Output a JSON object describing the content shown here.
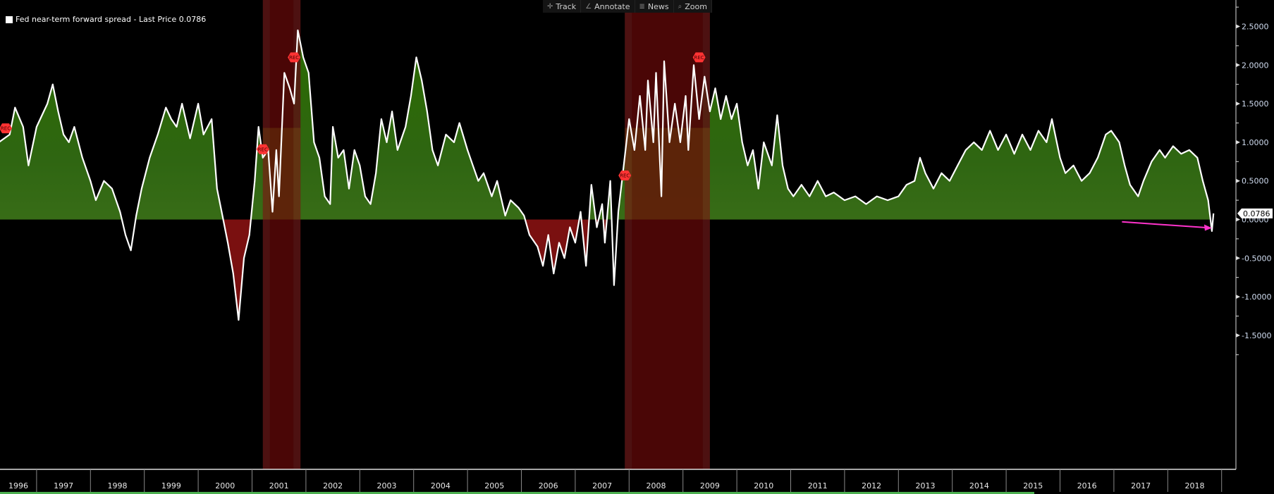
{
  "toolbar": {
    "items": [
      {
        "label": "Track",
        "icon": "crosshair-icon"
      },
      {
        "label": "Annotate",
        "icon": "pencil-icon"
      },
      {
        "label": "News",
        "icon": "news-icon"
      },
      {
        "label": "Zoom",
        "icon": "magnifier-icon"
      }
    ]
  },
  "legend": {
    "label": "Fed near-term forward spread - Last Price 0.0786"
  },
  "colors": {
    "line": "#ffffff",
    "positive_fill": "#3f7a12",
    "negative_fill": "#7a1010",
    "recession": "#4a0000",
    "rec_marker": "#ff3333",
    "arrow": "#ff33cc",
    "axis_text": "#d0dcf0"
  },
  "chart_data": {
    "type": "area",
    "title": "Fed near-term forward spread - Last Price 0.0786",
    "last_price": 0.0786,
    "last_price_label": "0.0786",
    "ylim": [
      -1.75,
      2.85
    ],
    "xlim": [
      1995.68,
      2019.6
    ],
    "yticks": [
      2.5,
      2.0,
      1.5,
      1.0,
      0.5,
      0.0,
      -0.5,
      -1.0,
      -1.5
    ],
    "ytick_labels": [
      "2.5000",
      "2.0000",
      "1.5000",
      "1.0000",
      "0.5000",
      "0.0000",
      "-0.5000",
      "-1.0000",
      "-1.5000"
    ],
    "xtick_labels": [
      "1996",
      "1997",
      "1998",
      "1999",
      "2000",
      "2001",
      "2002",
      "2003",
      "2004",
      "2005",
      "2006",
      "2007",
      "2008",
      "2009",
      "2010",
      "2011",
      "2012",
      "2013",
      "2014",
      "2015",
      "2016",
      "2017",
      "2018"
    ],
    "recessions": [
      [
        2001.2,
        2001.9
      ],
      [
        2007.92,
        2009.5
      ]
    ],
    "negative_shaded_periods": [
      [
        2000.4,
        2001.05
      ],
      [
        2006.0,
        2007.6
      ]
    ],
    "rec_markers": [
      {
        "label": "REC",
        "x": 1995.75,
        "y": 1.18
      },
      {
        "label": "REC",
        "x": 2001.2,
        "y": 0.91
      },
      {
        "label": "REC",
        "x": 2001.78,
        "y": 2.1
      },
      {
        "label": "REC",
        "x": 2007.92,
        "y": 0.57
      },
      {
        "label": "REC",
        "x": 2009.3,
        "y": 2.1
      }
    ],
    "arrow_annotation": {
      "from": [
        2017.15,
        -0.03
      ],
      "to": [
        2018.82,
        -0.11
      ]
    },
    "series": [
      {
        "name": "Fed near-term forward spread",
        "x": [
          1995.7,
          1996.3,
          1996.5,
          1996.6,
          1996.75,
          1996.85,
          1997.0,
          1997.2,
          1997.3,
          1997.4,
          1997.5,
          1997.6,
          1997.7,
          1997.85,
          1998.0,
          1998.1,
          1998.25,
          1998.4,
          1998.55,
          1998.65,
          1998.75,
          1998.85,
          1998.95,
          1999.1,
          1999.25,
          1999.4,
          1999.5,
          1999.6,
          1999.7,
          1999.85,
          2000.0,
          2000.1,
          2000.25,
          2000.35,
          2000.45,
          2000.55,
          2000.65,
          2000.75,
          2000.85,
          2000.95,
          2001.05,
          2001.12,
          2001.2,
          2001.3,
          2001.38,
          2001.45,
          2001.5,
          2001.6,
          2001.7,
          2001.78,
          2001.85,
          2001.95,
          2002.05,
          2002.15,
          2002.25,
          2002.35,
          2002.45,
          2002.5,
          2002.6,
          2002.7,
          2002.8,
          2002.9,
          2003.0,
          2003.1,
          2003.2,
          2003.3,
          2003.4,
          2003.5,
          2003.6,
          2003.7,
          2003.85,
          2003.95,
          2004.05,
          2004.15,
          2004.25,
          2004.35,
          2004.45,
          2004.6,
          2004.75,
          2004.85,
          2005.0,
          2005.1,
          2005.2,
          2005.3,
          2005.45,
          2005.55,
          2005.7,
          2005.8,
          2005.95,
          2006.05,
          2006.15,
          2006.3,
          2006.4,
          2006.5,
          2006.6,
          2006.7,
          2006.8,
          2006.9,
          2007.0,
          2007.1,
          2007.2,
          2007.3,
          2007.4,
          2007.5,
          2007.55,
          2007.65,
          2007.72,
          2007.8,
          2007.9,
          2008.0,
          2008.1,
          2008.2,
          2008.3,
          2008.35,
          2008.45,
          2008.5,
          2008.6,
          2008.65,
          2008.75,
          2008.85,
          2008.95,
          2009.05,
          2009.1,
          2009.2,
          2009.3,
          2009.4,
          2009.5,
          2009.6,
          2009.7,
          2009.8,
          2009.9,
          2010.0,
          2010.1,
          2010.2,
          2010.3,
          2010.4,
          2010.5,
          2010.65,
          2010.75,
          2010.85,
          2010.95,
          2011.05,
          2011.2,
          2011.35,
          2011.5,
          2011.65,
          2011.8,
          2012.0,
          2012.2,
          2012.4,
          2012.6,
          2012.8,
          2013.0,
          2013.15,
          2013.3,
          2013.4,
          2013.5,
          2013.65,
          2013.8,
          2013.95,
          2014.1,
          2014.25,
          2014.4,
          2014.55,
          2014.7,
          2014.85,
          2015.0,
          2015.15,
          2015.3,
          2015.45,
          2015.6,
          2015.75,
          2015.85,
          2016.0,
          2016.1,
          2016.25,
          2016.4,
          2016.55,
          2016.7,
          2016.85,
          2016.95,
          2017.1,
          2017.2,
          2017.3,
          2017.45,
          2017.55,
          2017.7,
          2017.85,
          2017.95,
          2018.1,
          2018.25,
          2018.4,
          2018.55,
          2018.65,
          2018.75,
          2018.82,
          2018.85
        ],
        "y": [
          0.95,
          1.0,
          1.1,
          1.45,
          1.2,
          0.7,
          1.2,
          1.5,
          1.75,
          1.4,
          1.1,
          1.0,
          1.2,
          0.8,
          0.5,
          0.25,
          0.5,
          0.4,
          0.1,
          -0.2,
          -0.4,
          0.05,
          0.4,
          0.8,
          1.1,
          1.45,
          1.3,
          1.2,
          1.5,
          1.05,
          1.5,
          1.1,
          1.3,
          0.4,
          0.05,
          -0.3,
          -0.7,
          -1.3,
          -0.5,
          -0.2,
          0.5,
          1.2,
          0.8,
          0.9,
          0.1,
          0.9,
          0.3,
          1.9,
          1.7,
          1.5,
          2.45,
          2.1,
          1.9,
          1.0,
          0.8,
          0.3,
          0.2,
          1.2,
          0.8,
          0.9,
          0.4,
          0.9,
          0.7,
          0.3,
          0.2,
          0.6,
          1.3,
          1.0,
          1.4,
          0.9,
          1.2,
          1.6,
          2.1,
          1.8,
          1.4,
          0.9,
          0.7,
          1.1,
          1.0,
          1.25,
          0.9,
          0.7,
          0.5,
          0.6,
          0.3,
          0.5,
          0.05,
          0.25,
          0.15,
          0.05,
          -0.2,
          -0.35,
          -0.6,
          -0.2,
          -0.7,
          -0.3,
          -0.5,
          -0.1,
          -0.3,
          0.1,
          -0.6,
          0.45,
          -0.1,
          0.2,
          -0.3,
          0.5,
          -0.85,
          0.1,
          0.7,
          1.3,
          0.9,
          1.6,
          0.9,
          1.8,
          1.0,
          1.9,
          0.3,
          2.05,
          1.0,
          1.5,
          1.0,
          1.6,
          0.9,
          2.0,
          1.3,
          1.85,
          1.4,
          1.7,
          1.3,
          1.6,
          1.3,
          1.5,
          1.0,
          0.7,
          0.9,
          0.4,
          1.0,
          0.7,
          1.35,
          0.7,
          0.4,
          0.3,
          0.45,
          0.3,
          0.5,
          0.3,
          0.35,
          0.25,
          0.3,
          0.2,
          0.3,
          0.25,
          0.3,
          0.45,
          0.5,
          0.8,
          0.6,
          0.4,
          0.6,
          0.5,
          0.7,
          0.9,
          1.0,
          0.9,
          1.15,
          0.9,
          1.1,
          0.85,
          1.1,
          0.9,
          1.15,
          1.0,
          1.3,
          0.8,
          0.6,
          0.7,
          0.5,
          0.6,
          0.8,
          1.1,
          1.15,
          1.0,
          0.7,
          0.45,
          0.3,
          0.5,
          0.75,
          0.9,
          0.8,
          0.95,
          0.85,
          0.9,
          0.8,
          0.5,
          0.25,
          -0.15,
          0.0786
        ]
      }
    ]
  }
}
